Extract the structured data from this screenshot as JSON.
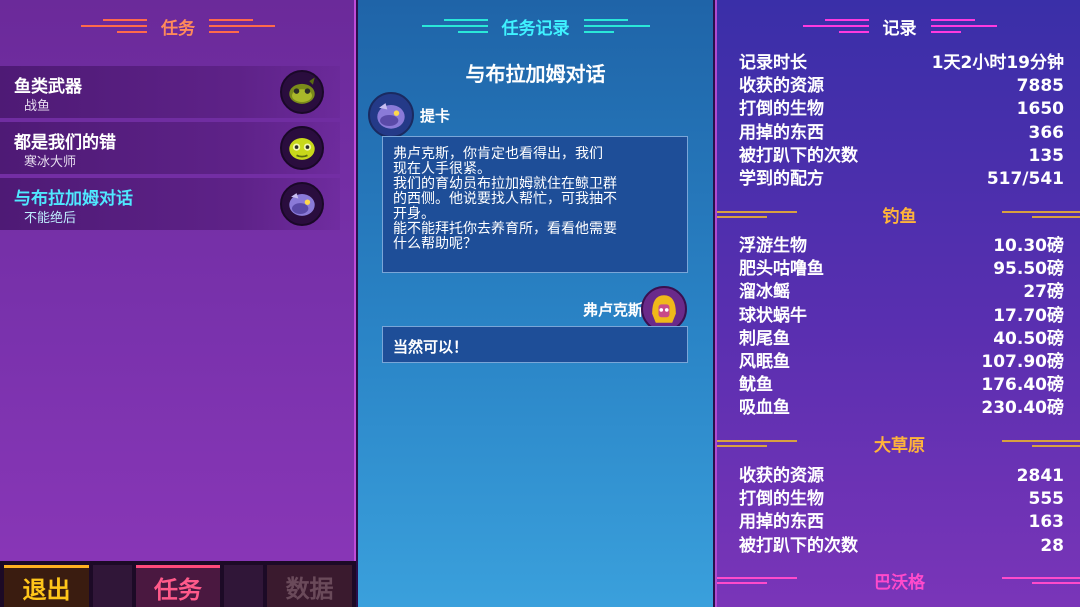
{
  "left": {
    "title": "任务",
    "quests": [
      {
        "name": "鱼类武器",
        "giver": "战鱼",
        "icon": "green-fish-creature-icon",
        "active": false
      },
      {
        "name": "都是我们的错",
        "giver": "寒冰大师",
        "icon": "yellow-green-fish-creature-icon",
        "active": false
      },
      {
        "name": "与布拉加姆对话",
        "giver": "不能绝后",
        "icon": "purple-fish-creature-icon",
        "active": true
      }
    ],
    "footer": {
      "quit": "退出",
      "quests": "任务",
      "data": "数据"
    }
  },
  "mid": {
    "title": "任务记录",
    "subtitle": "与布拉加姆对话",
    "speaker1": {
      "name": "提卡",
      "icon": "purple-fish-portrait-icon"
    },
    "message1": "弗卢克斯，你肯定也看得出，我们\n现在人手很紧。\n我们的育幼员布拉加姆就住在鲸卫群\n的西侧。他说要找人帮忙，可我抽不\n开身。\n能不能拜托你去养育所，看看他需要\n什么帮助呢？",
    "speaker2": {
      "name": "弗卢克斯",
      "icon": "gold-helmet-portrait-icon"
    },
    "message2": "当然可以！"
  },
  "right": {
    "title": "记录",
    "general": [
      {
        "k": "记录时长",
        "v": "1天2小时19分钟"
      },
      {
        "k": "收获的资源",
        "v": "7885"
      },
      {
        "k": "打倒的生物",
        "v": "1650"
      },
      {
        "k": "用掉的东西",
        "v": "366"
      },
      {
        "k": "被打趴下的次数",
        "v": "135"
      },
      {
        "k": "学到的配方",
        "v": "517/541"
      }
    ],
    "fishing_title": "钓鱼",
    "fishing": [
      {
        "k": "浮游生物",
        "v": "10.30磅"
      },
      {
        "k": "肥头咕噜鱼",
        "v": "95.50磅"
      },
      {
        "k": "溜冰鳐",
        "v": "27磅"
      },
      {
        "k": "球状蜗牛",
        "v": "17.70磅"
      },
      {
        "k": "刺尾鱼",
        "v": "40.50磅"
      },
      {
        "k": "风眠鱼",
        "v": "107.90磅"
      },
      {
        "k": "鱿鱼",
        "v": "176.40磅"
      },
      {
        "k": "吸血鱼",
        "v": "230.40磅"
      }
    ],
    "grassland_title": "大草原",
    "grassland": [
      {
        "k": "收获的资源",
        "v": "2841"
      },
      {
        "k": "打倒的生物",
        "v": "555"
      },
      {
        "k": "用掉的东西",
        "v": "163"
      },
      {
        "k": "被打趴下的次数",
        "v": "28"
      }
    ],
    "bavog_title": "巴沃格",
    "colors": {
      "accent_cyan": "#4fe8ff",
      "section_gold": "#ffb43a",
      "section_pink": "#ff4acb"
    }
  }
}
